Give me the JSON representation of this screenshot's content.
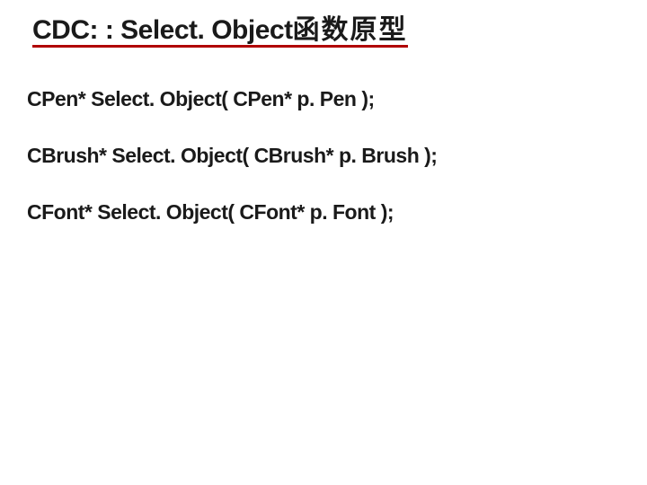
{
  "title": {
    "class_method": "CDC: : Select. Object",
    "suffix_zh": "函数原型"
  },
  "signatures": [
    "CPen* Select. Object( CPen* p. Pen );",
    "CBrush* Select. Object( CBrush* p. Brush );",
    "CFont* Select. Object( CFont* p. Font );"
  ]
}
